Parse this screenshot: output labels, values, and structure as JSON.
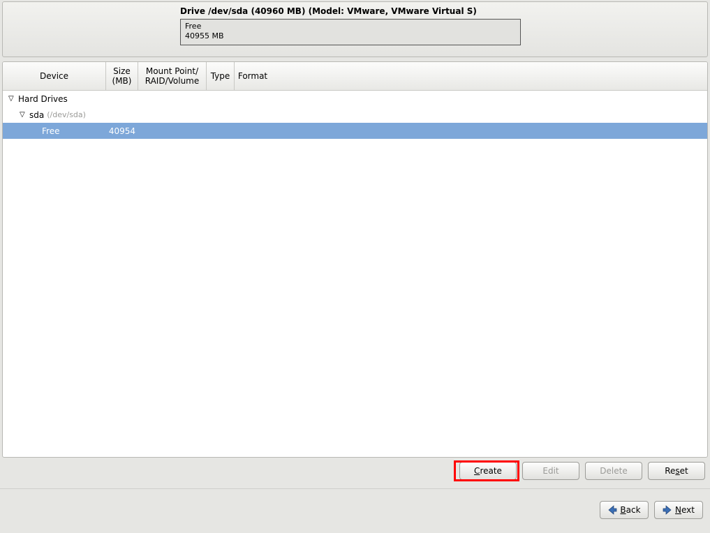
{
  "drive": {
    "title": "Drive /dev/sda (40960 MB) (Model: VMware, VMware Virtual S)",
    "free_label": "Free",
    "free_size": "40955 MB"
  },
  "columns": {
    "device": "Device",
    "size_l1": "Size",
    "size_l2": "(MB)",
    "mp_l1": "Mount Point/",
    "mp_l2": "RAID/Volume",
    "type": "Type",
    "format": "Format"
  },
  "tree": {
    "root_label": "Hard Drives",
    "sda_label": "sda",
    "sda_path": "(/dev/sda)",
    "free_label": "Free",
    "free_size": "40954"
  },
  "buttons": {
    "create": "Create",
    "edit": "Edit",
    "delete": "Delete",
    "reset": "Reset",
    "back": "Back",
    "next": "Next"
  }
}
